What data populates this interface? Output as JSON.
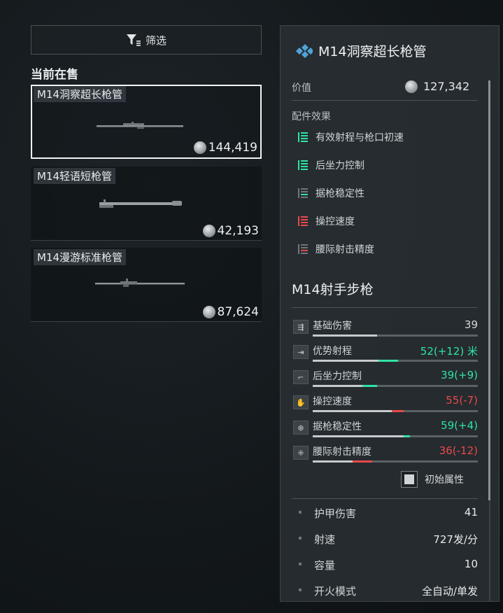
{
  "filter": {
    "label": "筛选",
    "icon": "filter-icon"
  },
  "section_title": "当前在售",
  "listings": [
    {
      "name": "M14洞察超长枪管",
      "price": "144,419",
      "selected": true
    },
    {
      "name": "M14轻语短枪管",
      "price": "42,193",
      "selected": false
    },
    {
      "name": "M14漫游标准枪管",
      "price": "87,624",
      "selected": false
    }
  ],
  "detail": {
    "title": "M14洞察超长枪管",
    "value_label": "价值",
    "value": "127,342",
    "effects_label": "配件效果",
    "effects": [
      {
        "label": "有效射程与枪口初速",
        "kind": "positive"
      },
      {
        "label": "后坐力控制",
        "kind": "positive"
      },
      {
        "label": "据枪稳定性",
        "kind": "neutral"
      },
      {
        "label": "操控速度",
        "kind": "negative"
      },
      {
        "label": "腰际射击精度",
        "kind": "neutral"
      }
    ],
    "weapon_name": "M14射手步枪",
    "stats": [
      {
        "label": "基础伤害",
        "value": "39",
        "icon": "damage-icon",
        "base": 39,
        "delta": 0,
        "color": "#d6dadc"
      },
      {
        "label": "优势射程",
        "value": "52(+12) 米",
        "icon": "range-icon",
        "base": 40,
        "delta": 12,
        "color": "#2fe3a4"
      },
      {
        "label": "后坐力控制",
        "value": "39(+9)",
        "icon": "recoil-icon",
        "base": 30,
        "delta": 9,
        "color": "#2fe3a4"
      },
      {
        "label": "操控速度",
        "value": "55(-7)",
        "icon": "handling-icon",
        "base": 55,
        "delta": -7,
        "color": "#e84a4a"
      },
      {
        "label": "据枪稳定性",
        "value": "59(+4)",
        "icon": "stability-icon",
        "base": 55,
        "delta": 4,
        "color": "#2fe3a4"
      },
      {
        "label": "腰际射击精度",
        "value": "36(-12)",
        "icon": "hipfire-icon",
        "base": 36,
        "delta": -12,
        "color": "#e84a4a"
      }
    ],
    "toggle_label": "初始属性",
    "attributes": [
      {
        "label": "护甲伤害",
        "value": "41"
      },
      {
        "label": "射速",
        "value": "727发/分"
      },
      {
        "label": "容量",
        "value": "10"
      },
      {
        "label": "开火模式",
        "value": "全自动/单发"
      }
    ]
  },
  "colors": {
    "positive": "#2fe3a4",
    "negative": "#e84a4a",
    "neutral": "#6f777b",
    "accent": "#4fa3d9"
  }
}
